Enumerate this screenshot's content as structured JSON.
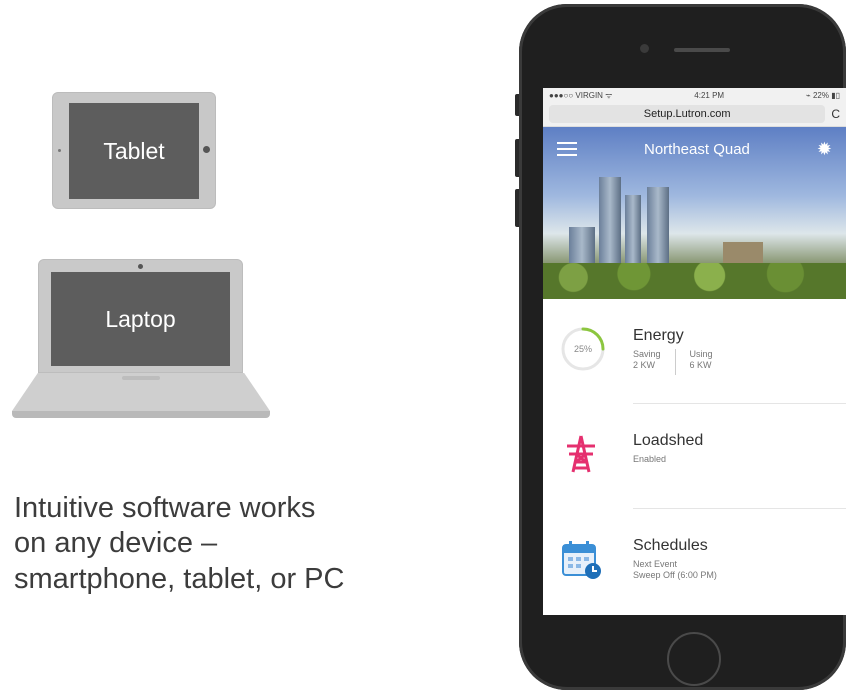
{
  "devices": {
    "tablet_label": "Tablet",
    "laptop_label": "Laptop"
  },
  "caption": {
    "line1": "Intuitive software works",
    "line2": "on any device –",
    "line3": "smartphone, tablet, or PC"
  },
  "phone": {
    "status": {
      "carrier": "●●●○○ VIRGIN ᯤ",
      "time": "4:21 PM",
      "battery": "⌁ 22% ▮▯"
    },
    "url": "Setup.Lutron.com",
    "reload_glyph": "C",
    "app_title": "Northeast Quad",
    "energy": {
      "name": "Energy",
      "gauge_value": "25%",
      "gauge_fraction": 0.25,
      "saving_label": "Saving",
      "saving_value": "2 KW",
      "using_label": "Using",
      "using_value": "6 KW",
      "accent": "#8cc63f"
    },
    "loadshed": {
      "name": "Loadshed",
      "status": "Enabled",
      "icon": "power-tower-icon",
      "color": "#e5306f"
    },
    "schedules": {
      "name": "Schedules",
      "next_label": "Next Event",
      "next_value": "Sweep Off (6:00 PM)",
      "icon": "calendar-clock-icon",
      "color": "#3b8fd6"
    }
  }
}
